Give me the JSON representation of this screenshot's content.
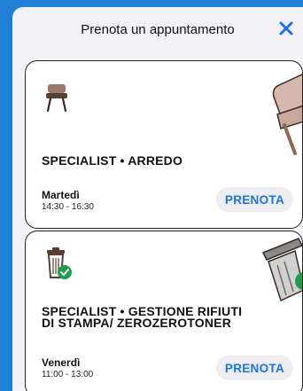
{
  "header": {
    "title": "Prenota un appuntamento",
    "close_icon": "close-x-icon"
  },
  "colors": {
    "accent": "#1a73e8",
    "background": "#1f7fd4",
    "sheet": "#f2f2f7"
  },
  "appointments": [
    {
      "name": "SPECIALIST • ARREDO",
      "day": "Martedì",
      "time": "14:30 - 16:30",
      "button": "PRENOTA",
      "icon": "chair-icon"
    },
    {
      "name": "SPECIALIST • GESTIONE RIFIUTI DI STAMPA/ ZEROZEROTONER",
      "day": "Venerdì",
      "time": "11:00 - 13:00",
      "button": "PRENOTA",
      "icon": "recycle-bin-icon"
    }
  ]
}
